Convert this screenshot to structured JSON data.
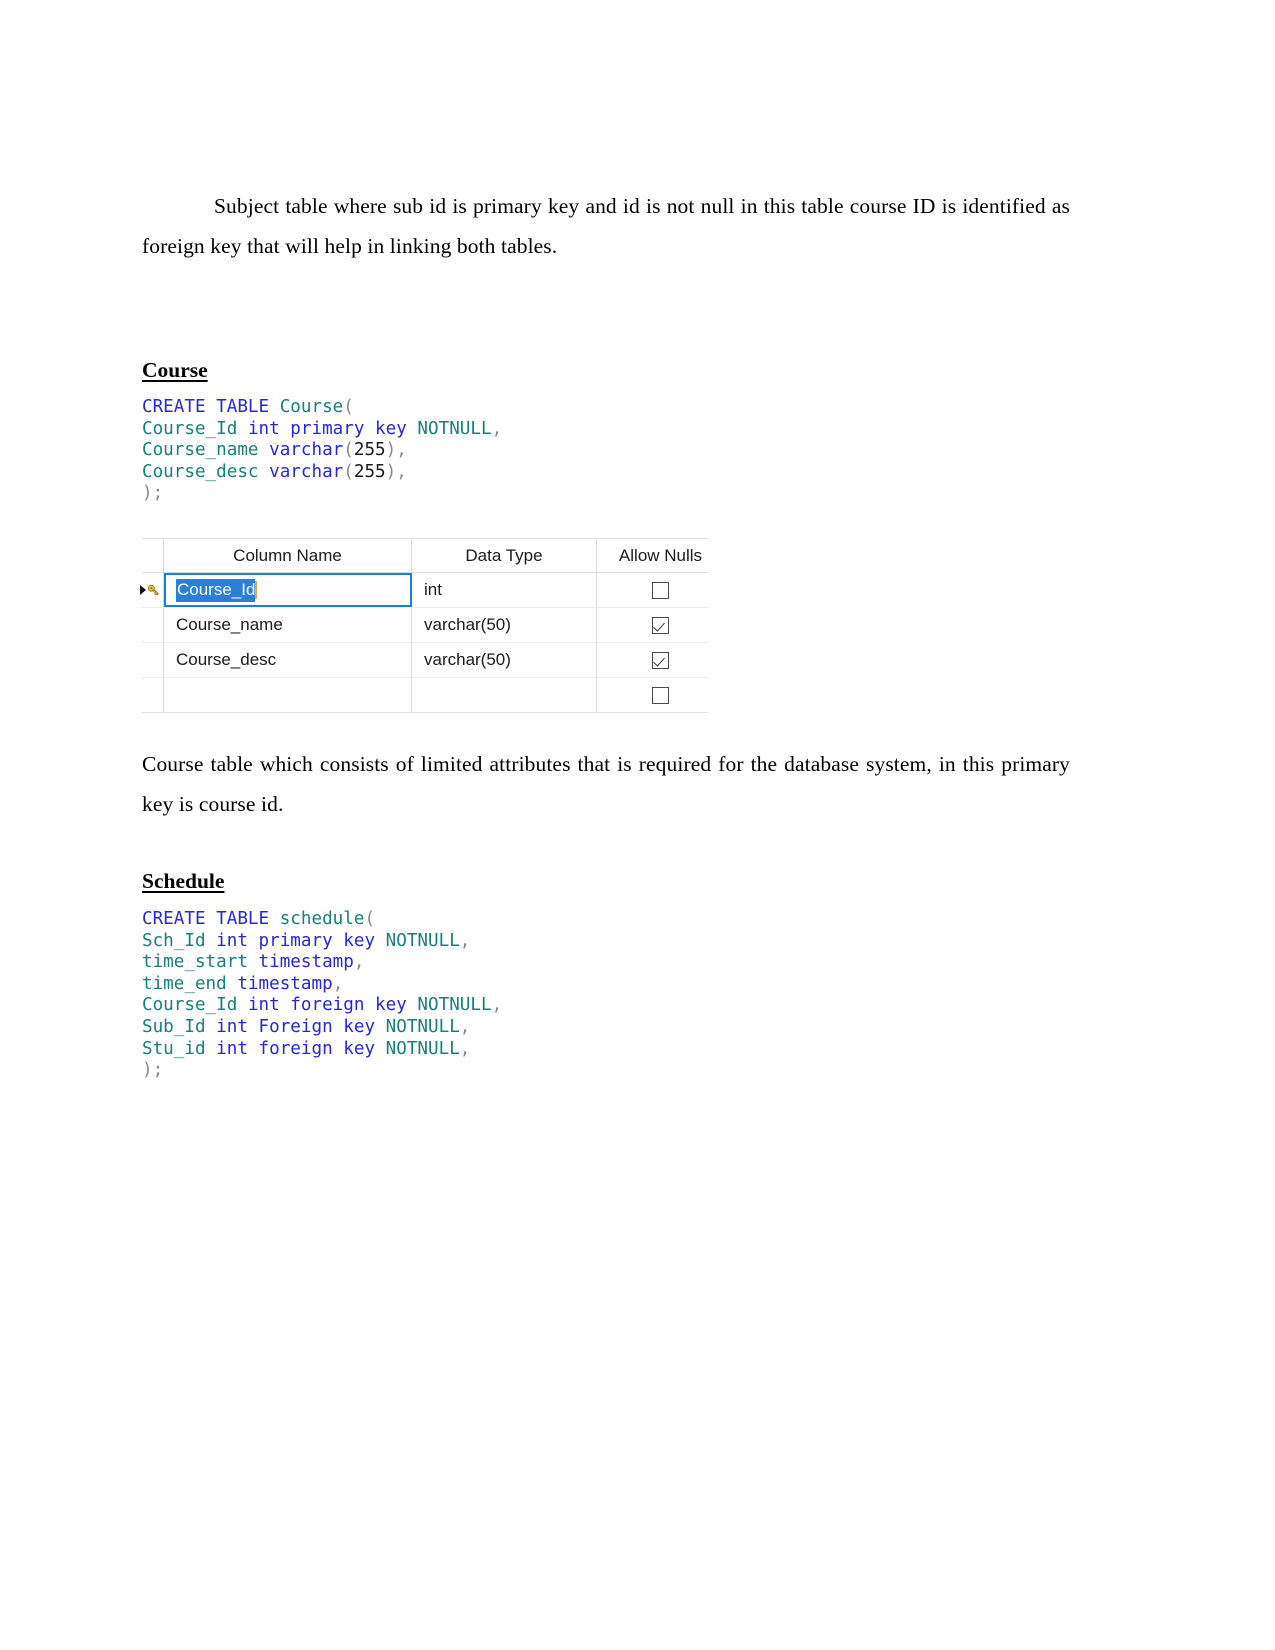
{
  "document": {
    "intro_paragraph": "Subject table where sub id is primary key and id is not null in this table course ID is identified as foreign key that will help in linking both tables.",
    "course_heading": "Course",
    "course_paragraph": "Course table which consists of limited attributes that is required for the database system, in this primary key is course id.",
    "schedule_heading": "Schedule"
  },
  "course_code": {
    "line1": {
      "kw": "CREATE TABLE",
      "id": "Course",
      "pun": "("
    },
    "line2": {
      "id": "Course_Id",
      "kw": "int primary key",
      "id2": "NOTNULL",
      "pun": ","
    },
    "line3": {
      "id": "Course_name",
      "kw": "varchar",
      "pun_open": "(",
      "num": "255",
      "pun_close": "),"
    },
    "line4": {
      "id": "Course_desc",
      "kw": "varchar",
      "pun_open": "(",
      "num": "255",
      "pun_close": "),"
    },
    "line5": {
      "pun": ");"
    }
  },
  "schedule_code": {
    "line1": {
      "kw": "CREATE TABLE",
      "id": "schedule",
      "pun": "("
    },
    "line2": {
      "id": "Sch_Id",
      "kw": "int primary key",
      "id2": "NOTNULL",
      "pun": ","
    },
    "line3": {
      "id": "time_start",
      "kw": "timestamp",
      "pun": ","
    },
    "line4": {
      "id": "time_end",
      "kw": "timestamp",
      "pun": ","
    },
    "line5": {
      "id": "Course_Id",
      "kw": "int foreign key",
      "id2": "NOTNULL",
      "pun": ","
    },
    "line6": {
      "id": "Sub_Id",
      "kw": "int Foreign key",
      "id2": "NOTNULL",
      "pun": ","
    },
    "line7": {
      "id": "Stu_id",
      "kw": "int foreign key",
      "id2": "NOTNULL",
      "pun": ","
    },
    "line8": {
      "pun": ");"
    }
  },
  "designer_grid": {
    "headers": [
      "Column Name",
      "Data Type",
      "Allow Nulls"
    ],
    "rows": [
      {
        "key": true,
        "selected": true,
        "name": "Course_Id",
        "type": "int",
        "allow_nulls": false
      },
      {
        "key": false,
        "selected": false,
        "name": "Course_name",
        "type": "varchar(50)",
        "allow_nulls": true
      },
      {
        "key": false,
        "selected": false,
        "name": "Course_desc",
        "type": "varchar(50)",
        "allow_nulls": true
      },
      {
        "key": false,
        "selected": false,
        "name": "",
        "type": "",
        "allow_nulls": false
      }
    ]
  },
  "colors": {
    "keyword_blue": "#2727d8",
    "identifier_teal": "#18807a",
    "punctuation_gray": "#8a8a8a",
    "selection_blue": "#2a7fd8",
    "focus_border": "#1a7fd4",
    "key_icon_yellow": "#e8c11a"
  }
}
